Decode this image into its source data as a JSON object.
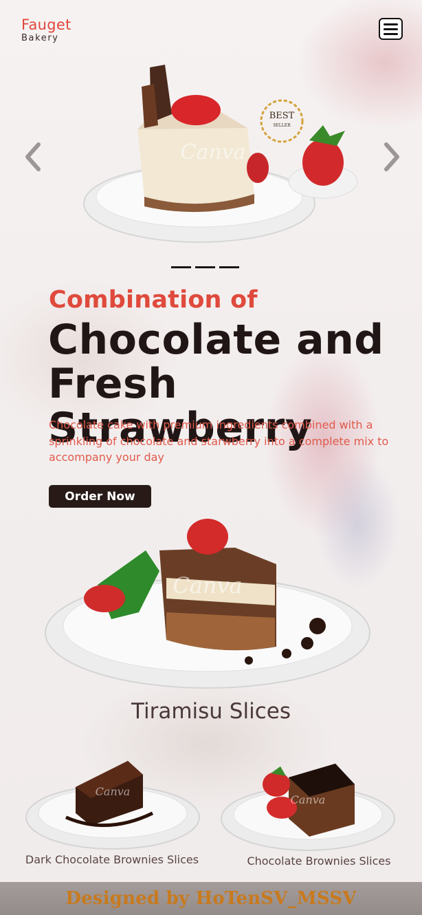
{
  "brand": {
    "name": "Fauget",
    "subtitle": "Bakery",
    "accent": "#e0473b"
  },
  "header": {
    "menu_icon": "hamburger-menu-icon"
  },
  "carousel": {
    "prev_icon": "chevron-left-icon",
    "next_icon": "chevron-right-icon",
    "badge": {
      "line1": "BEST",
      "line2": "SELLER"
    },
    "watermark": "Canva",
    "slide_count": 3
  },
  "hero": {
    "kicker": "Combination of",
    "headline_line1": "Chocolate and",
    "headline_line2": "Fresh Strawberry",
    "description": "Chocolate cake with premium ingredients combined with a sprinkling of chocolate and starwberry into a complete mix to accompany your day",
    "cta_label": "Order Now"
  },
  "featured": {
    "label": "Tiramisu Slices"
  },
  "products": [
    {
      "label": "Dark Chocolate Brownies Slices"
    },
    {
      "label": "Chocolate Brownies Slices"
    }
  ],
  "footer": {
    "text": "Designed by HoTenSV_MSSV"
  },
  "colors": {
    "dark": "#201615",
    "button": "#271a17",
    "footer_text": "#c87a1e"
  }
}
